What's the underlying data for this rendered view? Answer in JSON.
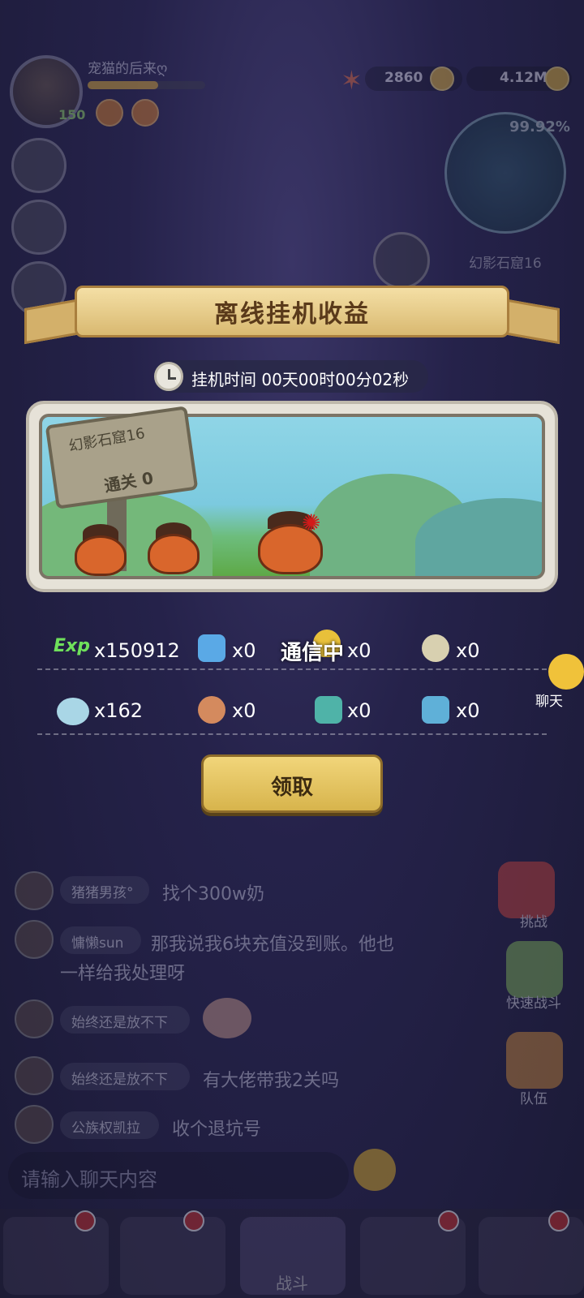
{
  "player": {
    "name": "宠猫的后来ღ",
    "level": "150",
    "exp_progress": 0.6
  },
  "resources": {
    "gems": "2860",
    "shells": "4.12M"
  },
  "minimap": {
    "percent": "99.92%"
  },
  "stage": {
    "current": "幻影石窟16"
  },
  "modal": {
    "title": "离线挂机收益",
    "timer": "挂机时间 00天00时00分02秒",
    "sign_line1": "幻影石窟16",
    "sign_line2": "通关 0",
    "status_overlay": "通信中",
    "claim_label": "领取",
    "rewards_row1": [
      {
        "icon": "exp-icon",
        "label": "Exp",
        "value": "x150912"
      },
      {
        "icon": "crystal-icon",
        "value": "x0"
      },
      {
        "icon": "flame-icon",
        "value": "x0"
      },
      {
        "icon": "coin-icon",
        "value": "x0"
      }
    ],
    "rewards_row2": [
      {
        "icon": "shell-icon",
        "value": "x162"
      },
      {
        "icon": "meat-icon",
        "value": "x0"
      },
      {
        "icon": "ore-icon",
        "value": "x0"
      },
      {
        "icon": "ice-crystal-icon",
        "value": "x0"
      }
    ]
  },
  "chat": {
    "messages": [
      {
        "name": "猪猪男孩°",
        "text": "找个300w奶"
      },
      {
        "name": "慵懒sun",
        "text": "那我说我6块充值没到账。他也",
        "text2": "一样给我处理呀"
      },
      {
        "name": "始终还是放不下",
        "text": ""
      },
      {
        "name": "始终还是放不下",
        "text": "有大佬带我2关吗"
      },
      {
        "name": "公族权凯拉",
        "text": "收个退坑号"
      }
    ],
    "placeholder": "请输入聊天内容",
    "chat_button_label": "聊天"
  },
  "side_buttons": {
    "challenge": "挑战",
    "quick_battle": "快速战斗",
    "team": "队伍"
  },
  "nav": {
    "battle": "战斗"
  },
  "colors": {
    "banner": "#e8cf8a",
    "claim_button": "#e3c460",
    "exp_label": "#6fe05b"
  }
}
